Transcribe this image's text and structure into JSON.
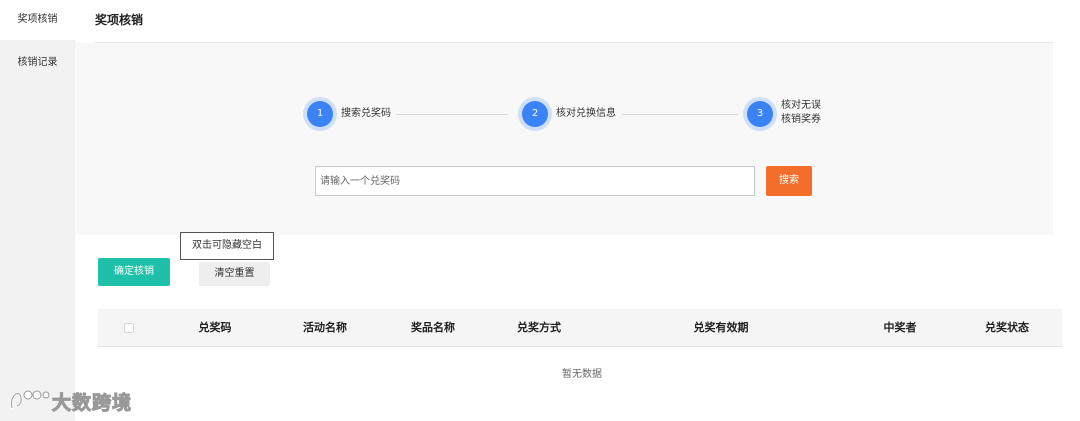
{
  "sidebar": {
    "items": [
      {
        "label": "奖项核销"
      },
      {
        "label": "核销记录"
      }
    ]
  },
  "page": {
    "title": "奖项核销"
  },
  "steps": [
    {
      "number": "1",
      "label": "搜索兑奖码"
    },
    {
      "number": "2",
      "label": "核对兑换信息"
    },
    {
      "number": "3",
      "label_line1": "核对无误",
      "label_line2": "核销奖券"
    }
  ],
  "search": {
    "placeholder": "请输入一个兑奖码",
    "value": "",
    "button_label": "搜索"
  },
  "tooltip": {
    "text": "双击可隐藏空白"
  },
  "actions": {
    "confirm_label": "确定核销",
    "reset_label": "清空重置"
  },
  "table": {
    "columns": [
      "兑奖码",
      "活动名称",
      "奖品名称",
      "兑奖方式",
      "兑奖有效期",
      "中奖者",
      "兑奖状态"
    ],
    "empty_text": "暂无数据"
  },
  "watermark": {
    "text": "大数跨境"
  },
  "colors": {
    "step_accent": "#3b82f6",
    "search_button": "#f36d2b",
    "confirm_button": "#1ec0a9"
  }
}
